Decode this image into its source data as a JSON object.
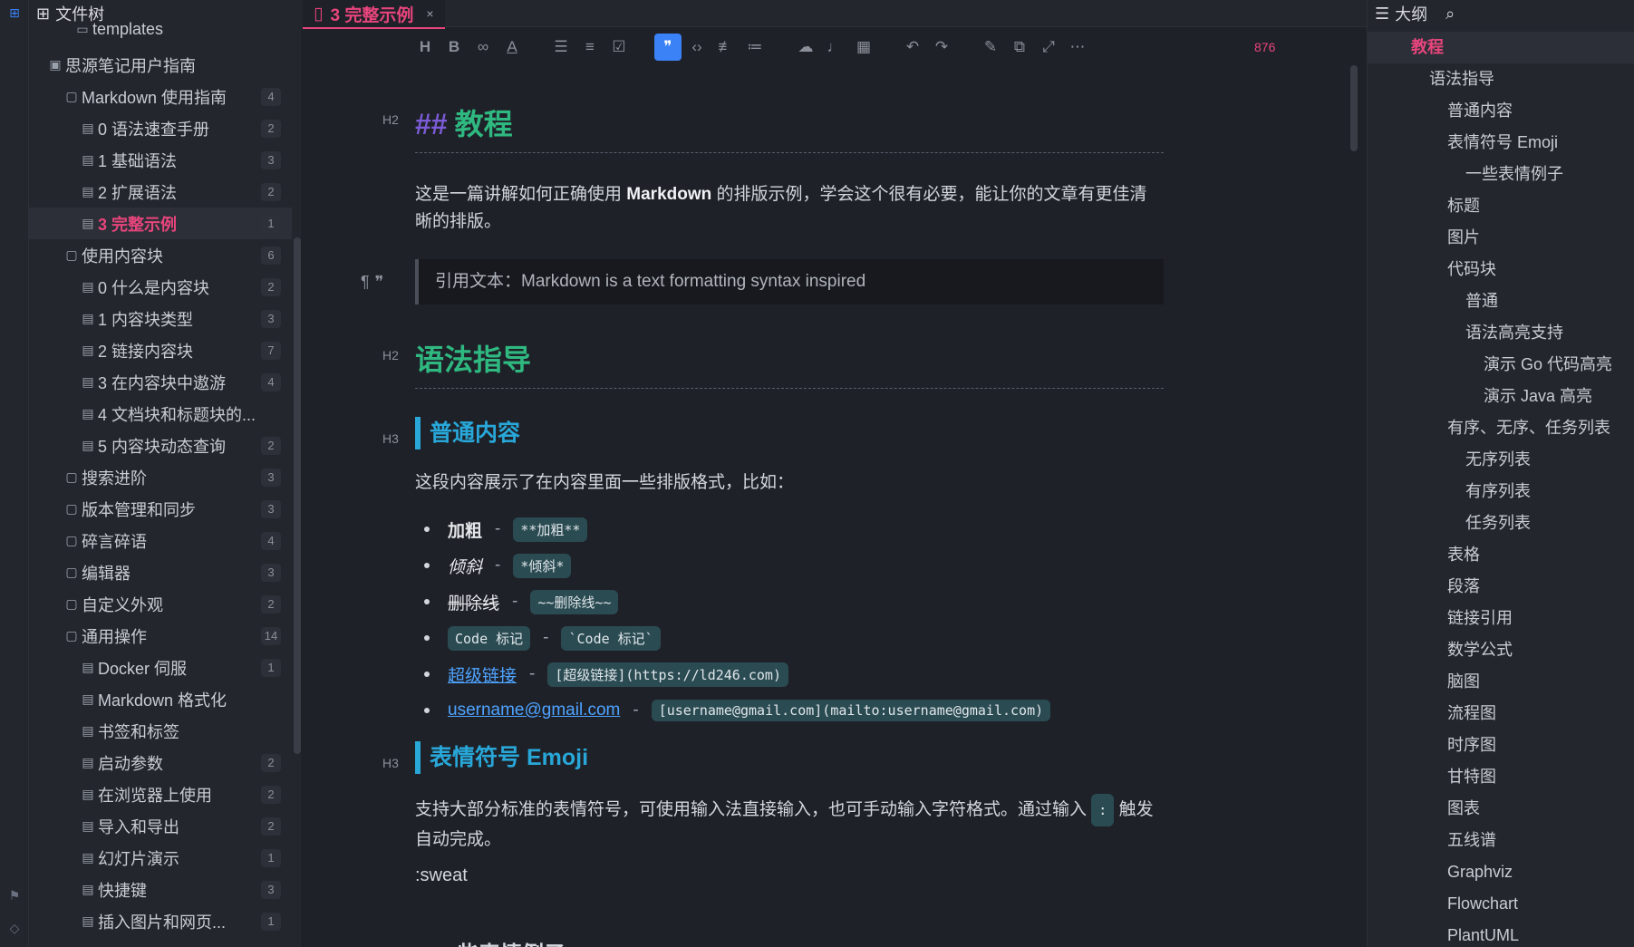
{
  "tree": {
    "title": "文件树",
    "top_partial": "templates",
    "items": [
      {
        "label": "思源笔记用户指南",
        "count": "",
        "depth": 0,
        "kind": "notebook"
      },
      {
        "label": "Markdown 使用指南",
        "count": "4",
        "depth": 1,
        "kind": "folder"
      },
      {
        "label": "0 语法速查手册",
        "count": "2",
        "depth": 2,
        "kind": "doc"
      },
      {
        "label": "1 基础语法",
        "count": "3",
        "depth": 2,
        "kind": "doc"
      },
      {
        "label": "2 扩展语法",
        "count": "2",
        "depth": 2,
        "kind": "doc"
      },
      {
        "label": "3 完整示例",
        "count": "1",
        "depth": 2,
        "kind": "doc",
        "active": true
      },
      {
        "label": "使用内容块",
        "count": "6",
        "depth": 1,
        "kind": "folder"
      },
      {
        "label": "0 什么是内容块",
        "count": "2",
        "depth": 2,
        "kind": "doc"
      },
      {
        "label": "1 内容块类型",
        "count": "3",
        "depth": 2,
        "kind": "doc"
      },
      {
        "label": "2 链接内容块",
        "count": "7",
        "depth": 2,
        "kind": "doc"
      },
      {
        "label": "3 在内容块中遨游",
        "count": "4",
        "depth": 2,
        "kind": "doc"
      },
      {
        "label": "4 文档块和标题块的...",
        "count": "",
        "depth": 2,
        "kind": "doc"
      },
      {
        "label": "5 内容块动态查询",
        "count": "2",
        "depth": 2,
        "kind": "doc"
      },
      {
        "label": "搜索进阶",
        "count": "3",
        "depth": 1,
        "kind": "folder"
      },
      {
        "label": "版本管理和同步",
        "count": "3",
        "depth": 1,
        "kind": "folder"
      },
      {
        "label": "碎言碎语",
        "count": "4",
        "depth": 1,
        "kind": "folder"
      },
      {
        "label": "编辑器",
        "count": "3",
        "depth": 1,
        "kind": "folder"
      },
      {
        "label": "自定义外观",
        "count": "2",
        "depth": 1,
        "kind": "folder"
      },
      {
        "label": "通用操作",
        "count": "14",
        "depth": 1,
        "kind": "folder"
      },
      {
        "label": "Docker 伺服",
        "count": "1",
        "depth": 2,
        "kind": "doc"
      },
      {
        "label": "Markdown 格式化",
        "count": "",
        "depth": 2,
        "kind": "doc"
      },
      {
        "label": "书签和标签",
        "count": "",
        "depth": 2,
        "kind": "doc"
      },
      {
        "label": "启动参数",
        "count": "2",
        "depth": 2,
        "kind": "doc"
      },
      {
        "label": "在浏览器上使用",
        "count": "2",
        "depth": 2,
        "kind": "doc"
      },
      {
        "label": "导入和导出",
        "count": "2",
        "depth": 2,
        "kind": "doc"
      },
      {
        "label": "幻灯片演示",
        "count": "1",
        "depth": 2,
        "kind": "doc"
      },
      {
        "label": "快捷键",
        "count": "3",
        "depth": 2,
        "kind": "doc"
      },
      {
        "label": "插入图片和网页...",
        "count": "1",
        "depth": 2,
        "kind": "doc"
      }
    ]
  },
  "tab": {
    "title": "3 完整示例",
    "close": "×"
  },
  "toolbar": {
    "word_count": "876"
  },
  "doc": {
    "h2_marker": "H2",
    "h3_marker": "H3",
    "h2_1": {
      "hash": "##",
      "text": "教程"
    },
    "intro_before": "这是一篇讲解如何正确使用 ",
    "intro_bold": "Markdown",
    "intro_after": " 的排版示例，学会这个很有必要，能让你的文章有更佳清晰的排版。",
    "quote": "引用文本：Markdown is a text formatting syntax inspired",
    "h2_2": "语法指导",
    "h3_1": "普通内容",
    "normal_intro": "这段内容展示了在内容里面一些排版格式，比如：",
    "bullets": [
      {
        "label": "加粗",
        "code": "**加粗**"
      },
      {
        "label": "倾斜",
        "code": "*倾斜*"
      },
      {
        "label": "删除线",
        "code": "~~删除线~~"
      },
      {
        "label": "Code 标记",
        "code": "`Code 标记`"
      },
      {
        "label": "超级链接",
        "code": "[超级链接](https://ld246.com)"
      },
      {
        "label": "username@gmail.com",
        "code": "[username@gmail.com](mailto:username@gmail.com)"
      }
    ],
    "h3_2": "表情符号 Emoji",
    "emoji_text_before": "支持大部分标准的表情符号，可使用输入法直接输入，也可手动输入字符格式。通过输入 ",
    "emoji_colon": ":",
    "emoji_text_after": " 触发自动完成。",
    "sweat": ":sweat",
    "h4_partial": "一些表情例子"
  },
  "outline": {
    "title": "大纲",
    "items": [
      {
        "label": "教程",
        "level": 0,
        "active": true
      },
      {
        "label": "语法指导",
        "level": 1
      },
      {
        "label": "普通内容",
        "level": 2
      },
      {
        "label": "表情符号 Emoji",
        "level": 2
      },
      {
        "label": "一些表情例子",
        "level": 3
      },
      {
        "label": "标题",
        "level": 2
      },
      {
        "label": "图片",
        "level": 2
      },
      {
        "label": "代码块",
        "level": 2
      },
      {
        "label": "普通",
        "level": 3
      },
      {
        "label": "语法高亮支持",
        "level": 3
      },
      {
        "label": "演示 Go 代码高亮",
        "level": 4
      },
      {
        "label": "演示 Java 高亮",
        "level": 4
      },
      {
        "label": "有序、无序、任务列表",
        "level": 2
      },
      {
        "label": "无序列表",
        "level": 3
      },
      {
        "label": "有序列表",
        "level": 3
      },
      {
        "label": "任务列表",
        "level": 3
      },
      {
        "label": "表格",
        "level": 2
      },
      {
        "label": "段落",
        "level": 2
      },
      {
        "label": "链接引用",
        "level": 2
      },
      {
        "label": "数学公式",
        "level": 2
      },
      {
        "label": "脑图",
        "level": 2
      },
      {
        "label": "流程图",
        "level": 2
      },
      {
        "label": "时序图",
        "level": 2
      },
      {
        "label": "甘特图",
        "level": 2
      },
      {
        "label": "图表",
        "level": 2
      },
      {
        "label": "五线谱",
        "level": 2
      },
      {
        "label": "Graphviz",
        "level": 2
      },
      {
        "label": "Flowchart",
        "level": 2
      },
      {
        "label": "PlantUML",
        "level": 2
      }
    ]
  },
  "colors": {
    "accent": "#e8457c",
    "h2": "#2fb880",
    "h3": "#28a7d8",
    "hash": "#7b5bd6",
    "link": "#4ea3ff"
  }
}
